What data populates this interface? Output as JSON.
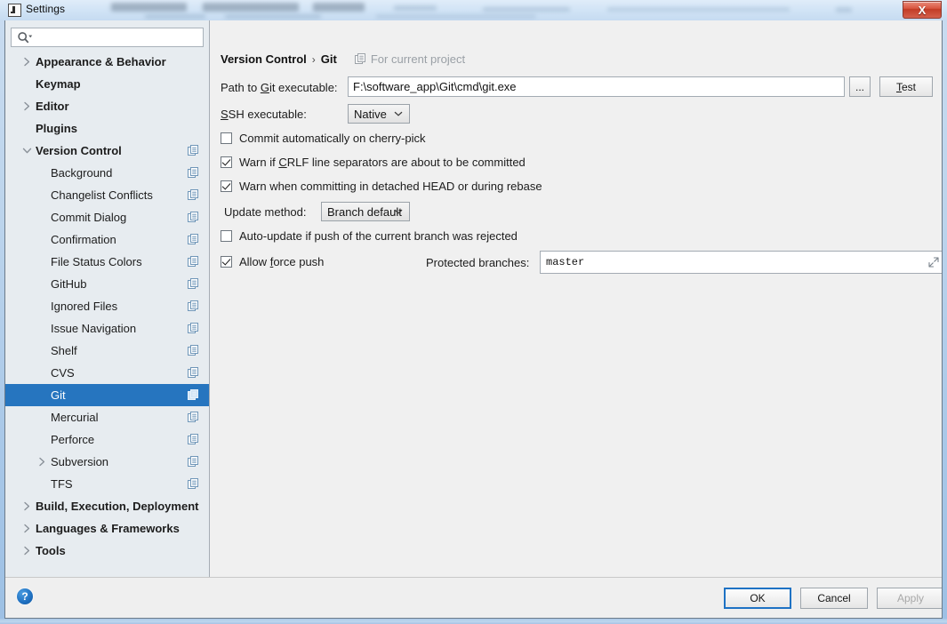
{
  "window": {
    "title": "Settings",
    "app_icon": "intellij-idea-icon",
    "close_label": "X"
  },
  "sidebar": {
    "search": {
      "value": "",
      "placeholder": "",
      "icon": "search-icon"
    },
    "items": [
      {
        "label": "Appearance & Behavior",
        "indent": 0,
        "bold": true,
        "twisty": "collapsed",
        "scope_icon": false,
        "selected": false
      },
      {
        "label": "Keymap",
        "indent": 0,
        "bold": true,
        "twisty": "none",
        "scope_icon": false,
        "selected": false
      },
      {
        "label": "Editor",
        "indent": 0,
        "bold": true,
        "twisty": "collapsed",
        "scope_icon": false,
        "selected": false
      },
      {
        "label": "Plugins",
        "indent": 0,
        "bold": true,
        "twisty": "none",
        "scope_icon": false,
        "selected": false
      },
      {
        "label": "Version Control",
        "indent": 0,
        "bold": true,
        "twisty": "expanded",
        "scope_icon": true,
        "selected": false
      },
      {
        "label": "Background",
        "indent": 1,
        "bold": false,
        "twisty": "none",
        "scope_icon": true,
        "selected": false
      },
      {
        "label": "Changelist Conflicts",
        "indent": 1,
        "bold": false,
        "twisty": "none",
        "scope_icon": true,
        "selected": false
      },
      {
        "label": "Commit Dialog",
        "indent": 1,
        "bold": false,
        "twisty": "none",
        "scope_icon": true,
        "selected": false
      },
      {
        "label": "Confirmation",
        "indent": 1,
        "bold": false,
        "twisty": "none",
        "scope_icon": true,
        "selected": false
      },
      {
        "label": "File Status Colors",
        "indent": 1,
        "bold": false,
        "twisty": "none",
        "scope_icon": true,
        "selected": false
      },
      {
        "label": "GitHub",
        "indent": 1,
        "bold": false,
        "twisty": "none",
        "scope_icon": true,
        "selected": false
      },
      {
        "label": "Ignored Files",
        "indent": 1,
        "bold": false,
        "twisty": "none",
        "scope_icon": true,
        "selected": false
      },
      {
        "label": "Issue Navigation",
        "indent": 1,
        "bold": false,
        "twisty": "none",
        "scope_icon": true,
        "selected": false
      },
      {
        "label": "Shelf",
        "indent": 1,
        "bold": false,
        "twisty": "none",
        "scope_icon": true,
        "selected": false
      },
      {
        "label": "CVS",
        "indent": 1,
        "bold": false,
        "twisty": "none",
        "scope_icon": true,
        "selected": false
      },
      {
        "label": "Git",
        "indent": 1,
        "bold": false,
        "twisty": "none",
        "scope_icon": true,
        "selected": true
      },
      {
        "label": "Mercurial",
        "indent": 1,
        "bold": false,
        "twisty": "none",
        "scope_icon": true,
        "selected": false
      },
      {
        "label": "Perforce",
        "indent": 1,
        "bold": false,
        "twisty": "none",
        "scope_icon": true,
        "selected": false
      },
      {
        "label": "Subversion",
        "indent": 1,
        "bold": false,
        "twisty": "collapsed",
        "scope_icon": true,
        "selected": false
      },
      {
        "label": "TFS",
        "indent": 1,
        "bold": false,
        "twisty": "none",
        "scope_icon": true,
        "selected": false
      },
      {
        "label": "Build, Execution, Deployment",
        "indent": 0,
        "bold": true,
        "twisty": "collapsed",
        "scope_icon": false,
        "selected": false
      },
      {
        "label": "Languages & Frameworks",
        "indent": 0,
        "bold": true,
        "twisty": "collapsed",
        "scope_icon": false,
        "selected": false
      },
      {
        "label": "Tools",
        "indent": 0,
        "bold": true,
        "twisty": "collapsed",
        "scope_icon": false,
        "selected": false
      }
    ]
  },
  "panel": {
    "breadcrumb": {
      "parent": "Version Control",
      "separator": "›",
      "current": "Git",
      "scope_text": "For current project",
      "scope_icon": "project-scope-icon"
    },
    "path_label_pre": "Path to ",
    "path_label_mnemonic": "G",
    "path_label_post": "it executable:",
    "path_value": "F:\\software_app\\Git\\cmd\\git.exe",
    "browse_label": "...",
    "test_label_mnemonic": "T",
    "test_label_post": "est",
    "ssh_label_mnemonic": "S",
    "ssh_label_post": "SH executable:",
    "ssh_value": "Native",
    "update_method_label": "Update method:",
    "update_method_value": "Branch default",
    "protected_branches_label": "Protected branches:",
    "protected_branches_value": "master",
    "checkboxes": [
      {
        "pre": "Commit automatically on cherry-pick",
        "mnemonic": "",
        "post": "",
        "checked": false,
        "name": "commit-automatically-on-cherry-pick"
      },
      {
        "pre": "Warn if ",
        "mnemonic": "C",
        "post": "RLF line separators are about to be committed",
        "checked": true,
        "name": "warn-if-crlf-line-separators"
      },
      {
        "pre": "Warn when committing in detached HEAD or during rebase",
        "mnemonic": "",
        "post": "",
        "checked": true,
        "name": "warn-when-committing-detached-head"
      },
      {
        "pre": "Auto-update if push of the current branch was rejected",
        "mnemonic": "",
        "post": "",
        "checked": false,
        "name": "auto-update-if-push-rejected"
      },
      {
        "pre": "Allow ",
        "mnemonic": "f",
        "post": "orce push",
        "checked": true,
        "name": "allow-force-push"
      }
    ]
  },
  "footer": {
    "help_label": "?",
    "ok_label": "OK",
    "cancel_label": "Cancel",
    "apply_label": "Apply",
    "apply_disabled": true
  },
  "colors": {
    "accent": "#2675bf",
    "sidebar_bg": "#e7ecf0",
    "panel_bg": "#f0f0f0",
    "scope_icon": "#6f96b8",
    "close_red": "#c23c26"
  }
}
